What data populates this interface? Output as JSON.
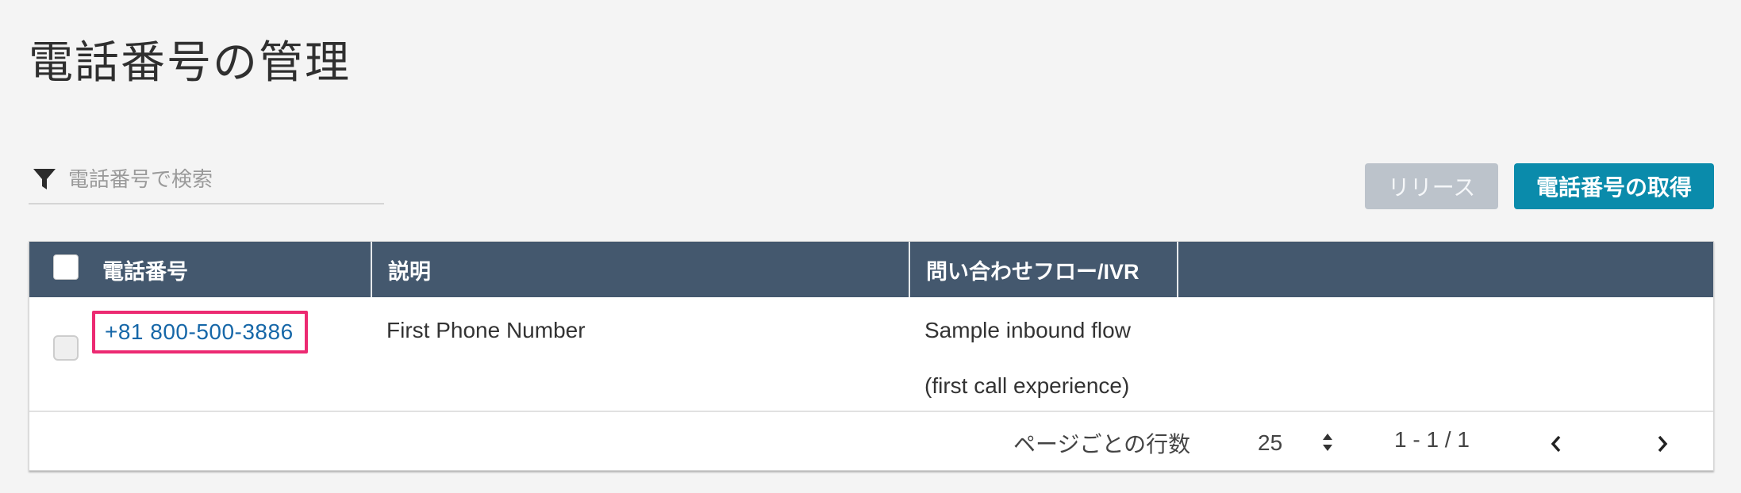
{
  "page": {
    "title": "電話番号の管理"
  },
  "search": {
    "placeholder": "電話番号で検索",
    "icon": "filter-icon"
  },
  "actions": {
    "release_label": "リリース",
    "claim_label": "電話番号の取得"
  },
  "table": {
    "columns": [
      "電話番号",
      "説明",
      "問い合わせフロー/IVR",
      ""
    ],
    "rows": [
      {
        "phone": "+81 800-500-3886",
        "description": "First Phone Number",
        "flow_line1": "Sample inbound flow",
        "flow_line2": "(first call experience)"
      }
    ]
  },
  "pagination": {
    "rows_per_page_label": "ページごとの行数",
    "rows_per_page": "25",
    "range": "1 - 1 / 1"
  },
  "colors": {
    "header_bg": "#44586e",
    "primary_button": "#0a8bab",
    "disabled_button": "#bcc3cb",
    "link": "#1667a8",
    "highlight": "#ec2a72"
  }
}
